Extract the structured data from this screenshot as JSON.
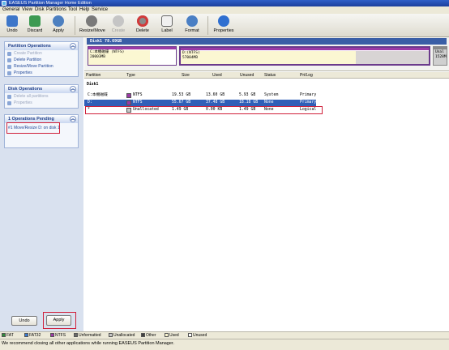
{
  "window": {
    "title": "EASEUS Partition Manager Home Edition"
  },
  "menu": [
    "General",
    "View",
    "Disk",
    "Partitions",
    "Tool",
    "Help",
    "Service"
  ],
  "toolbar": [
    {
      "label": "Undo",
      "icon": "undo-icon",
      "enabled": true
    },
    {
      "label": "Discard",
      "icon": "discard-icon",
      "enabled": true
    },
    {
      "label": "Apply",
      "icon": "apply-icon",
      "enabled": true
    },
    {
      "label": "Resize/Move",
      "icon": "resize-move-icon",
      "enabled": true
    },
    {
      "label": "Create",
      "icon": "create-icon",
      "enabled": false
    },
    {
      "label": "Delete",
      "icon": "delete-icon",
      "enabled": true
    },
    {
      "label": "Label",
      "icon": "label-icon",
      "enabled": true
    },
    {
      "label": "Format",
      "icon": "format-icon",
      "enabled": true
    },
    {
      "label": "Properties",
      "icon": "properties-icon",
      "enabled": true
    }
  ],
  "sidebar": {
    "partition_ops": {
      "title": "Partition Operations",
      "items": [
        "Create Partition",
        "Delete Partition",
        "Resize/Move Partition",
        "Properties"
      ]
    },
    "disk_ops": {
      "title": "Disk Operations",
      "items": [
        "Delete all partitions",
        "Properties"
      ]
    },
    "pending": {
      "title": "1 Operations Pending",
      "items": [
        "#1 Move/Resize D: on disk 1"
      ]
    },
    "undo_label": "Undo",
    "apply_label": "Apply"
  },
  "diskmap": {
    "header": "Disk1  78.69GB",
    "partitions": [
      {
        "name": "C:本機磁碟 (NTFS)",
        "size": "20003MB"
      },
      {
        "name": "D:(NTFS)",
        "size": "57004MB"
      },
      {
        "name": "Unal",
        "size": "1528M"
      }
    ]
  },
  "table": {
    "columns": [
      "Partition",
      "Type",
      "Size",
      "Used",
      "Unused",
      "Status",
      "Pri/Log"
    ],
    "disk_label": "Disk1",
    "rows": [
      {
        "partition": "C:本機磁碟",
        "type": "NTFS",
        "size": "19.53 GB",
        "used": "13.60 GB",
        "unused": "5.93 GB",
        "status": "System",
        "prilog": "Primary",
        "color": "#9b3aa6"
      },
      {
        "partition": "D:",
        "type": "NTFS",
        "size": "55.67 GB",
        "used": "37.48 GB",
        "unused": "18.18 GB",
        "status": "None",
        "prilog": "Primary",
        "color": "#9b3aa6"
      },
      {
        "partition": "*",
        "type": "Unallocated",
        "size": "1.49 GB",
        "used": "0.00 KB",
        "unused": "1.49 GB",
        "status": "None",
        "prilog": "Logical",
        "color": "#c8c8c8"
      }
    ]
  },
  "legend": [
    {
      "label": "FAT",
      "color": "#2f8a3a"
    },
    {
      "label": "FAT32",
      "color": "#3a7ad0"
    },
    {
      "label": "NTFS",
      "color": "#9b3aa6"
    },
    {
      "label": "Unformatted",
      "color": "#6a6a6a"
    },
    {
      "label": "Unallocated",
      "color": "#c8c8c8"
    },
    {
      "label": "Other",
      "color": "#404040"
    },
    {
      "label": "Used",
      "color": "#fbf7d2"
    },
    {
      "label": "Unused",
      "color": "#ffffff"
    }
  ],
  "status": {
    "message": "We recommend closing all other applications while running EASEUS Partition Manager."
  }
}
